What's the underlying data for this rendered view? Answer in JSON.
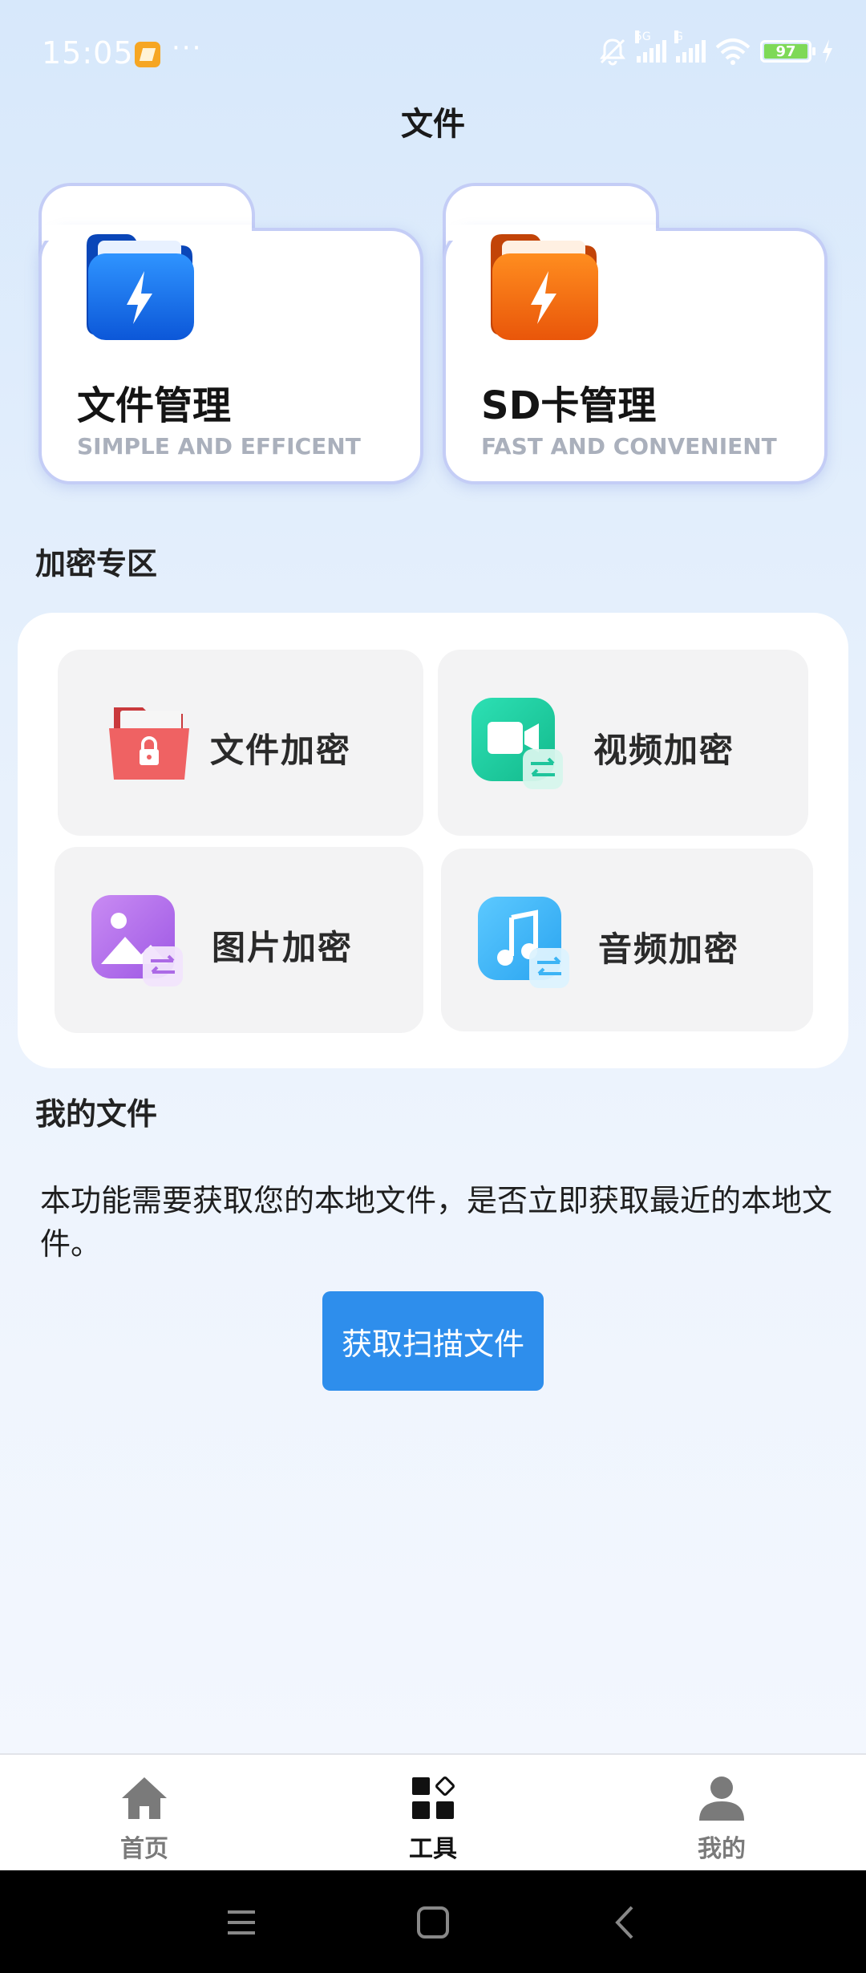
{
  "status_bar": {
    "time": "15:05",
    "more": "···",
    "battery": "97",
    "signal_1_label": "5G",
    "signal_2_label": "G"
  },
  "header": {
    "title": "文件"
  },
  "storage_cards": [
    {
      "title": "文件管理",
      "subtitle": "SIMPLE AND EFFICENT",
      "icon": "blue-folder-icon",
      "color": "#1e7cf0"
    },
    {
      "title": "SD卡管理",
      "subtitle": "FAST AND CONVENIENT",
      "icon": "orange-folder-icon",
      "color": "#f36b0d"
    }
  ],
  "encrypt_section": {
    "title": "加密专区",
    "items": [
      {
        "label": "文件加密",
        "icon": "file-lock-icon",
        "color": "#ef5f60"
      },
      {
        "label": "视频加密",
        "icon": "video-icon",
        "color": "#19c9a0"
      },
      {
        "label": "图片加密",
        "icon": "image-icon",
        "color": "#b06ae8"
      },
      {
        "label": "音频加密",
        "icon": "music-icon",
        "color": "#3cb4f5"
      }
    ]
  },
  "my_files": {
    "title": "我的文件",
    "description": "本功能需要获取您的本地文件，是否立即获取最近的本地文件。",
    "button": "获取扫描文件"
  },
  "tab_bar": {
    "items": [
      {
        "label": "首页",
        "icon": "home-icon",
        "active": false
      },
      {
        "label": "工具",
        "icon": "tools-icon",
        "active": true
      },
      {
        "label": "我的",
        "icon": "person-icon",
        "active": false
      }
    ]
  },
  "colors": {
    "accent": "#2e8eec",
    "active_tab": "#111111",
    "inactive_tab": "#7a7a7a"
  }
}
